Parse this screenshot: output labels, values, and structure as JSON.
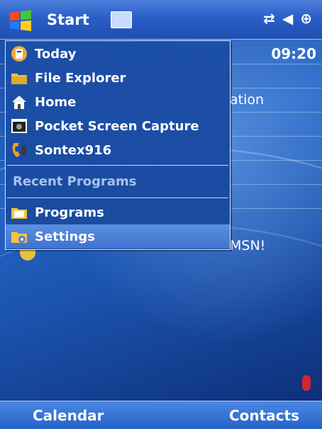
{
  "topbar": {
    "start_label": "Start",
    "icons": [
      "windows-logo-icon",
      "keyboard-icon",
      "connectivity-icon",
      "volume-icon",
      "battery-icon"
    ]
  },
  "today_screen": {
    "time": "09:20",
    "partial_text_1": "ation",
    "partial_text_2": "MSN!"
  },
  "start_menu": {
    "items": [
      {
        "label": "Today",
        "icon": "today-icon"
      },
      {
        "label": "File Explorer",
        "icon": "folder-icon"
      },
      {
        "label": "Home",
        "icon": "home-icon"
      },
      {
        "label": "Pocket Screen Capture",
        "icon": "camera-icon"
      },
      {
        "label": "Sontex916",
        "icon": "phone-icon"
      }
    ],
    "recent_heading": "Recent Programs",
    "bottom_items": [
      {
        "label": "Programs",
        "icon": "programs-folder-icon"
      },
      {
        "label": "Settings",
        "icon": "settings-folder-icon",
        "selected": true
      }
    ]
  },
  "softkeys": {
    "left": "Calendar",
    "right": "Contacts"
  },
  "colors": {
    "topbar": "#2a5fc7",
    "menu_bg": "#1c4fa8",
    "selected": "#4f84da",
    "recent_text": "#a9c2ec"
  }
}
